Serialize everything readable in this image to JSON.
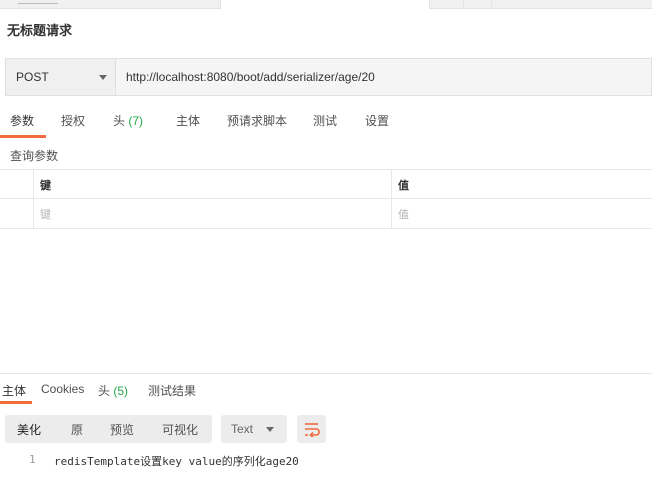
{
  "request": {
    "title": "无标题请求",
    "method": "POST",
    "url": "http://localhost:8080/boot/add/serializer/age/20"
  },
  "request_tabs": [
    {
      "label": "参数",
      "count": ""
    },
    {
      "label": "授权",
      "count": ""
    },
    {
      "label": "头",
      "count": "(7)"
    },
    {
      "label": "主体",
      "count": ""
    },
    {
      "label": "预请求脚本",
      "count": ""
    },
    {
      "label": "测试",
      "count": ""
    },
    {
      "label": "设置",
      "count": ""
    }
  ],
  "params": {
    "section_label": "查询参数",
    "header_key": "键",
    "header_value": "值",
    "placeholder_key": "键",
    "placeholder_value": "值"
  },
  "response_tabs": [
    {
      "label": "主体",
      "count": ""
    },
    {
      "label": "Cookies",
      "count": ""
    },
    {
      "label": "头",
      "count": "(5)"
    },
    {
      "label": "测试结果",
      "count": ""
    }
  ],
  "view_modes": [
    "美化",
    "原",
    "预览",
    "可视化"
  ],
  "format": {
    "selected": "Text"
  },
  "response_body": {
    "lines": [
      {
        "number": "1",
        "text": "redisTemplate设置key value的序列化age20"
      }
    ]
  },
  "icons": {
    "method_dropdown": "chevron-down-icon",
    "format_dropdown": "chevron-down-icon",
    "wrap_lines": "wrap-lines-icon"
  },
  "colors": {
    "accent": "#f26b3a",
    "count": "#26a84a"
  }
}
